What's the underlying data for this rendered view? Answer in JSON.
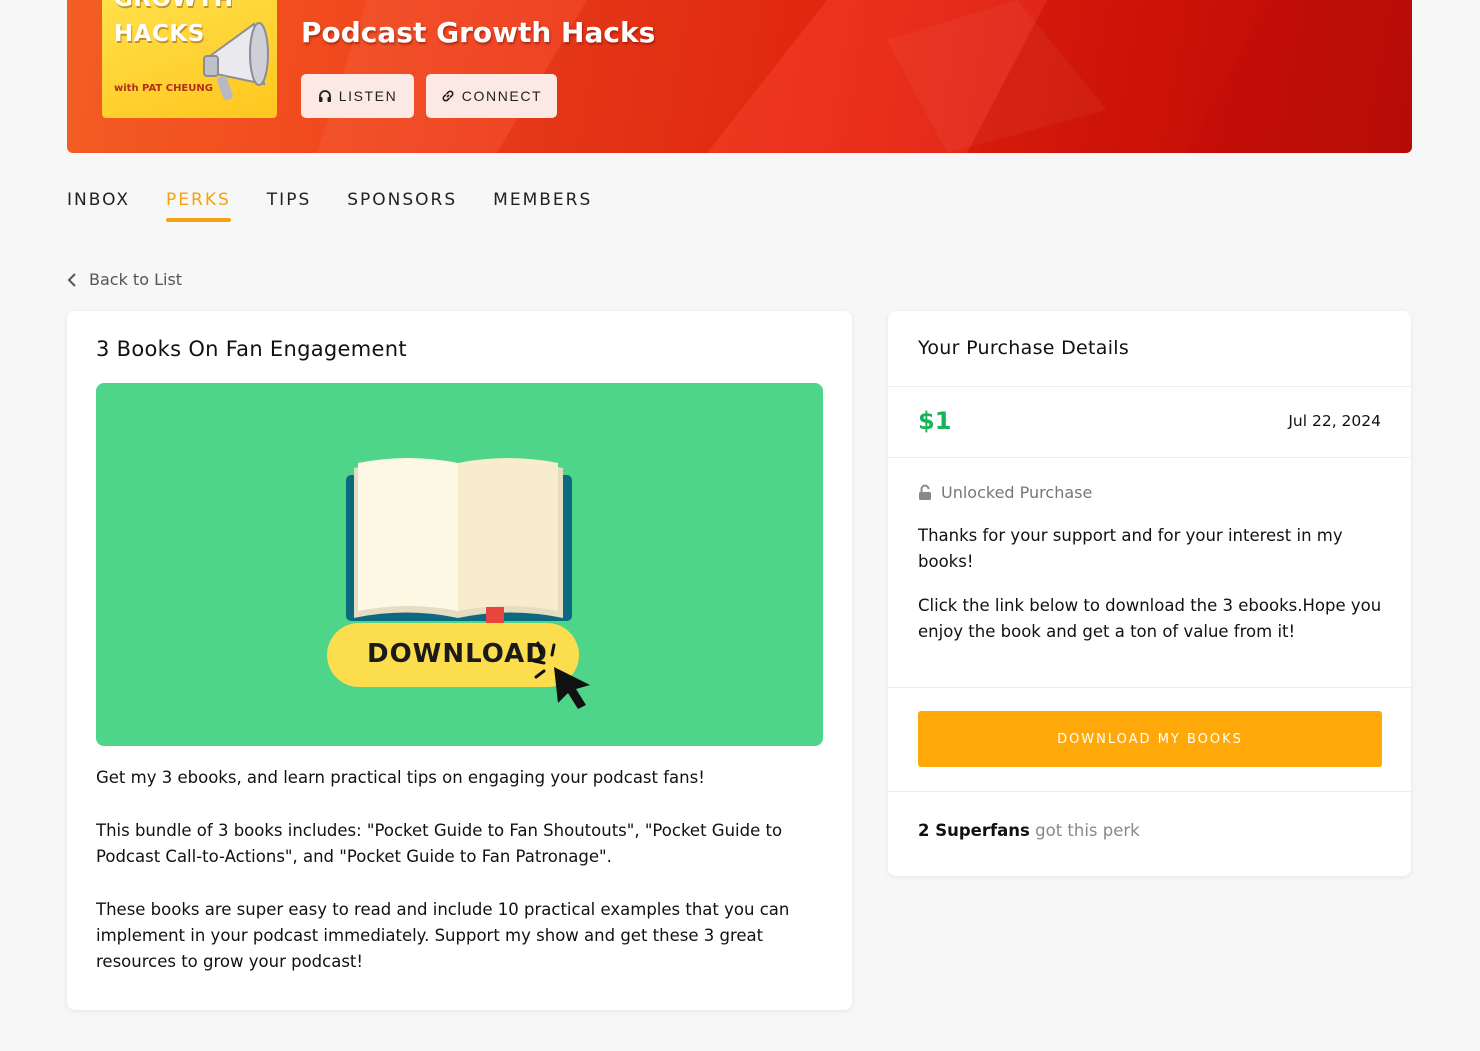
{
  "header": {
    "cover": {
      "line1": "GROWTH",
      "line2": "HACKS",
      "byline": "with PAT CHEUNG",
      "icon": "megaphone-icon"
    },
    "show_title": "Podcast Growth Hacks",
    "listen_label": "LISTEN",
    "connect_label": "CONNECT",
    "colors": {
      "banner_start": "#f35e24",
      "banner_end": "#c40d07"
    }
  },
  "tabs": [
    {
      "label": "INBOX",
      "active": false
    },
    {
      "label": "PERKS",
      "active": true
    },
    {
      "label": "TIPS",
      "active": false
    },
    {
      "label": "SPONSORS",
      "active": false
    },
    {
      "label": "MEMBERS",
      "active": false
    }
  ],
  "back_label": "Back to List",
  "perk": {
    "title": "3 Books On Fan Engagement",
    "image_text": "DOWNLOAD",
    "description": [
      "Get my 3 ebooks, and learn practical tips on engaging your podcast fans!",
      "This bundle of 3 books includes: \"Pocket Guide to Fan Shoutouts\", \"Pocket Guide to Podcast Call-to-Actions\", and \"Pocket Guide to Fan Patronage\".",
      "These books are super easy to read and include 10 practical examples that you can implement in your podcast immediately. Support my show and get these 3 great resources to grow your podcast!"
    ]
  },
  "purchase": {
    "title": "Your Purchase Details",
    "price": "$1",
    "date": "Jul 22, 2024",
    "unlock_label": "Unlocked Purchase",
    "messages": [
      "Thanks for your support and for your interest in my books!",
      "Click the link below to download the 3 ebooks.Hope you enjoy the book and get a ton of value from it!"
    ],
    "download_label": "DOWNLOAD MY BOOKS",
    "fans_count": "2 Superfans",
    "fans_rest": " got this perk",
    "colors": {
      "price": "#19b35a",
      "button": "#ffa80a",
      "accent": "#f4a20f"
    }
  }
}
